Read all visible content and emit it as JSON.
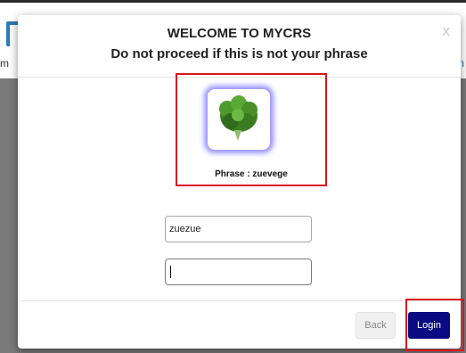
{
  "background": {
    "left_edge_letter": "m",
    "right_edge_letter": "n"
  },
  "modal": {
    "title_line1": "WELCOME TO MYCRS",
    "title_line2": "Do not proceed if this is not your phrase",
    "close_glyph": "x",
    "phrase_image_icon": "vegetable-kale-icon",
    "phrase_label": "Phrase : zuevege",
    "username_value": "zuezue",
    "password_value": "",
    "back_label": "Back",
    "login_label": "Login"
  },
  "colors": {
    "highlight_red": "#d8171c",
    "login_button": "#0a0a82",
    "image_glow": "#786eff"
  }
}
